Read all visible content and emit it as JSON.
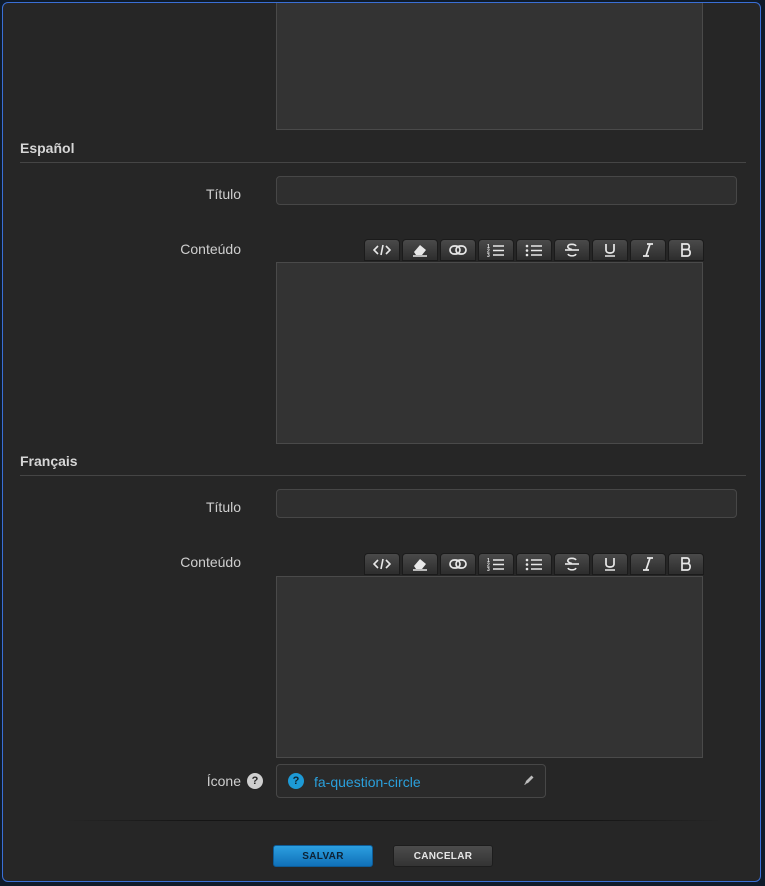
{
  "sections": [
    {
      "title": "Español",
      "title_label": "Título",
      "content_label": "Conteúdo"
    },
    {
      "title": "Français",
      "title_label": "Título",
      "content_label": "Conteúdo"
    }
  ],
  "toolbar_icons": [
    "code-icon",
    "eraser-icon",
    "link-icon",
    "ordered-list-icon",
    "unordered-list-icon",
    "strikethrough-icon",
    "underline-icon",
    "italic-icon",
    "bold-icon"
  ],
  "icon_field": {
    "label": "Ícone",
    "help": "?",
    "value": "fa-question-circle",
    "icon_glyph": "?"
  },
  "buttons": {
    "save": "SALVAR",
    "cancel": "CANCELAR"
  },
  "colors": {
    "accent": "#1d9ad6",
    "dialog_bg": "#262626",
    "border": "#3a6fd6"
  }
}
